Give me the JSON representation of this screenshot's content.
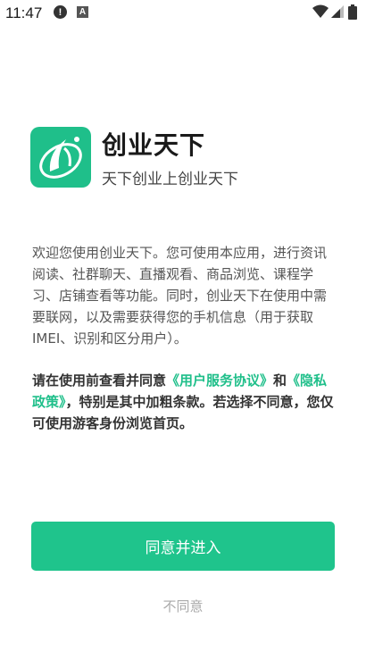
{
  "status_bar": {
    "time": "11:47",
    "alert_icon_glyph": "!",
    "a_icon_glyph": "A"
  },
  "app": {
    "name": "创业天下",
    "slogan": "天下创业上创业天下",
    "brand_color": "#1fc48c"
  },
  "intro_text": "欢迎您使用创业天下。您可使用本应用，进行资讯阅读、社群聊天、直播观看、商品浏览、课程学习、店铺查看等功能。同时，创业天下在使用中需要联网，以及需要获得您的手机信息（用于获取IMEI、识别和区分用户）。",
  "agreement": {
    "prefix": "请在使用前查看并同意",
    "user_agreement_link": "《用户服务协议》",
    "and": "和",
    "privacy_link": "《隐私政策》",
    "suffix": "，特别是其中加粗条款。若选择不同意，您仅可使用游客身份浏览首页。"
  },
  "buttons": {
    "agree": "同意并进入",
    "disagree": "不同意"
  }
}
